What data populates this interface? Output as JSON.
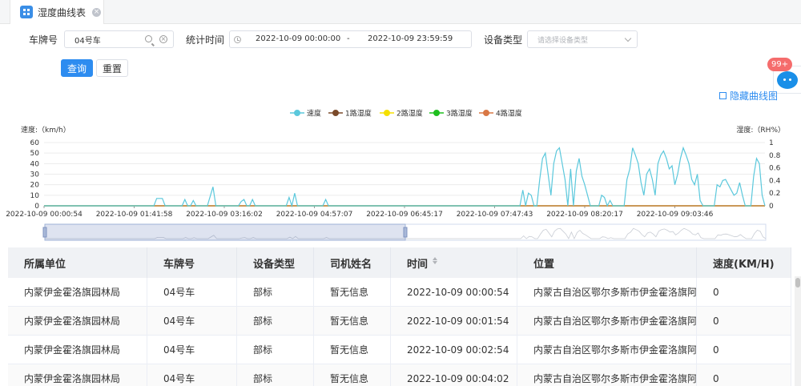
{
  "tab": {
    "label": "湿度曲线表"
  },
  "filters": {
    "plate_label": "车牌号",
    "plate_value": "04号车",
    "time_label": "统计时间",
    "time_start": "2022-10-09 00:00:00",
    "time_sep": "-",
    "time_end": "2022-10-09 23:59:59",
    "device_label": "设备类型",
    "device_placeholder": "请选择设备类型"
  },
  "buttons": {
    "query": "查询",
    "reset": "重置"
  },
  "chat": {
    "badge": "99+"
  },
  "hide_curve_label": "隐藏曲线图",
  "colors": {
    "primary": "#2d8cf0",
    "speed": "#5bc8dc",
    "ch1": "#7b4a2a",
    "ch2": "#f5e000",
    "ch3": "#1fbf1f",
    "ch4": "#d97845"
  },
  "chart_data": {
    "type": "line",
    "legend": [
      "速度",
      "1路湿度",
      "2路湿度",
      "3路湿度",
      "4路湿度"
    ],
    "ylabel_left": "速度:（km/h）",
    "ylabel_right": "湿度:（RH%）",
    "ylim_left": [
      0,
      60
    ],
    "yticks_left": [
      "0",
      "10",
      "20",
      "30",
      "40",
      "50",
      "60"
    ],
    "ylim_right": [
      0,
      1
    ],
    "yticks_right": [
      "0",
      "0.2",
      "0.4",
      "0.6",
      "0.8",
      "1"
    ],
    "x_ticks": [
      "2022-10-09 00:00:54",
      "2022-10-09 01:41:58",
      "2022-10-09 03:16:02",
      "2022-10-09 04:57:07",
      "2022-10-09 06:45:17",
      "2022-10-09 07:47:43",
      "2022-10-09 08:20:17",
      "2022-10-09 09:03:46"
    ],
    "series": [
      {
        "name": "速度",
        "values": [
          0,
          0,
          0,
          0,
          0,
          0,
          0,
          0,
          0,
          0,
          0,
          0,
          0,
          0,
          0,
          0,
          0,
          0,
          0,
          0,
          0,
          0,
          0,
          0,
          0,
          0,
          0,
          0,
          0,
          0,
          0,
          0,
          0,
          0,
          0,
          0,
          0,
          0,
          0,
          0,
          7,
          7,
          7,
          0,
          0,
          0,
          0,
          0,
          0,
          0,
          6,
          0,
          0,
          5,
          0,
          0,
          0,
          0,
          0,
          9,
          18,
          0,
          0,
          0,
          0,
          0,
          0,
          0,
          0,
          0,
          4,
          6,
          0,
          0,
          6,
          0,
          0,
          0,
          0,
          0,
          0,
          0,
          0,
          0,
          0,
          0,
          0,
          8,
          0,
          12,
          0,
          0,
          0,
          0,
          0,
          0,
          0,
          0,
          0,
          0,
          6,
          0,
          0,
          0,
          0,
          0,
          0,
          0,
          0,
          0,
          0,
          0,
          0,
          0,
          0,
          0,
          0,
          0,
          0,
          0,
          0,
          0,
          0,
          0,
          0,
          0,
          0,
          0,
          0,
          0,
          0,
          0,
          0,
          0,
          0,
          0,
          0,
          0,
          0,
          0,
          0,
          0,
          0,
          0,
          0,
          0,
          0,
          0,
          0,
          0,
          0,
          0,
          0,
          0,
          0,
          0,
          0,
          0,
          0,
          0,
          0,
          0,
          0,
          0,
          0,
          0,
          0,
          0,
          0,
          0,
          15,
          0,
          12,
          10,
          0,
          0,
          25,
          45,
          50,
          30,
          10,
          40,
          52,
          55,
          40,
          25,
          0,
          35,
          0,
          33,
          45,
          28,
          20,
          10,
          0,
          0,
          0,
          0,
          10,
          8,
          0,
          5,
          0,
          0,
          0,
          0,
          0,
          25,
          35,
          55,
          48,
          40,
          22,
          10,
          30,
          35,
          25,
          10,
          40,
          48,
          52,
          45,
          35,
          38,
          20,
          30,
          45,
          55,
          48,
          40,
          25,
          20,
          30,
          5,
          0,
          0,
          0,
          0,
          0,
          20,
          18,
          24,
          25,
          20,
          15,
          10,
          12,
          22,
          10,
          0,
          0,
          0,
          28,
          45,
          40,
          10,
          0
        ],
        "line_style": "solid"
      },
      {
        "name": "1路湿度",
        "values": [
          0,
          0,
          0,
          0,
          0,
          0,
          0,
          0,
          0
        ],
        "line_style": "solid"
      },
      {
        "name": "2路湿度",
        "values": [
          0,
          0,
          0,
          0,
          0,
          0,
          0,
          0,
          0
        ],
        "line_style": "solid"
      },
      {
        "name": "3路湿度",
        "values": [
          0,
          0,
          0,
          0,
          0,
          0,
          0,
          0,
          0
        ],
        "line_style": "solid"
      },
      {
        "name": "4路湿度",
        "values": [
          0,
          0,
          0,
          0,
          0,
          0,
          0,
          0,
          0
        ],
        "line_style": "solid"
      }
    ],
    "grid": true,
    "legend_position": "top-center"
  },
  "table": {
    "columns": [
      "所属单位",
      "车牌号",
      "设备类型",
      "司机姓名",
      "时间",
      "位置",
      "速度(KM/H)"
    ],
    "sortable": [
      false,
      false,
      false,
      false,
      true,
      false,
      false
    ],
    "rows": [
      [
        "内蒙伊金霍洛旗园林局",
        "04号车",
        "部标",
        "暂无信息",
        "2022-10-09 00:00:54",
        "内蒙古自治区鄂尔多斯市伊金霍洛旗阿勒腾",
        "0"
      ],
      [
        "内蒙伊金霍洛旗园林局",
        "04号车",
        "部标",
        "暂无信息",
        "2022-10-09 00:01:54",
        "内蒙古自治区鄂尔多斯市伊金霍洛旗阿勒腾",
        "0"
      ],
      [
        "内蒙伊金霍洛旗园林局",
        "04号车",
        "部标",
        "暂无信息",
        "2022-10-09 00:02:54",
        "内蒙古自治区鄂尔多斯市伊金霍洛旗阿勒腾",
        "0"
      ],
      [
        "内蒙伊金霍洛旗园林局",
        "04号车",
        "部标",
        "暂无信息",
        "2022-10-09 00:04:02",
        "内蒙古自治区鄂尔多斯市伊金霍洛旗阿勒腾",
        "0"
      ]
    ]
  }
}
